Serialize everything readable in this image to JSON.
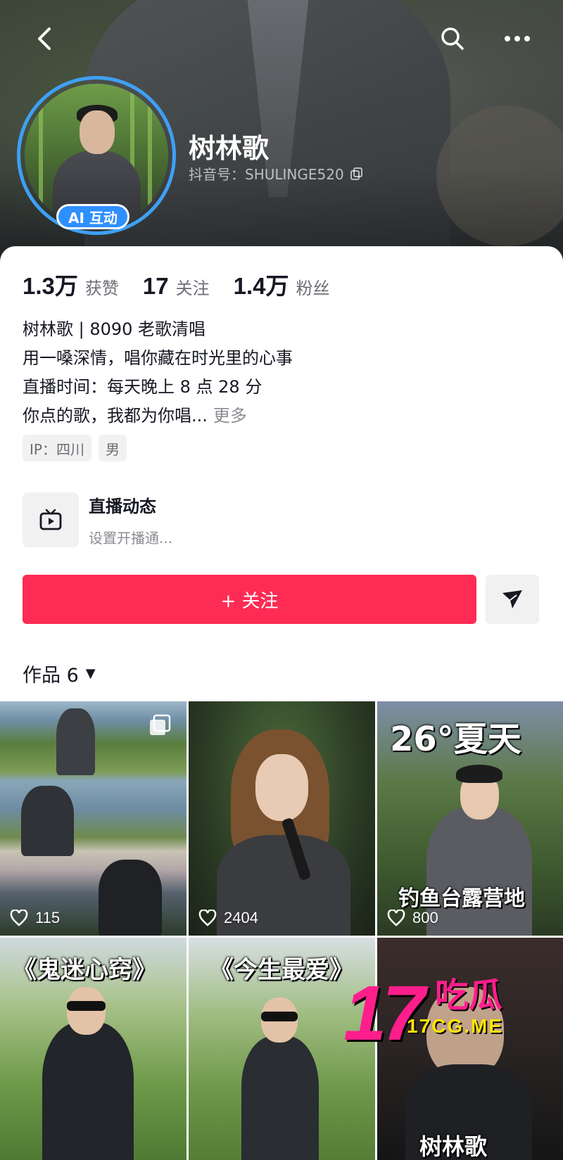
{
  "header": {
    "name": "树林歌",
    "douyin_id": "抖音号：SHULINGE520",
    "ai_badge": "AI 互动"
  },
  "stats": [
    {
      "num": "1.3万",
      "label": "获赞"
    },
    {
      "num": "17",
      "label": "关注"
    },
    {
      "num": "1.4万",
      "label": "粉丝"
    }
  ],
  "bio": {
    "line1": "树林歌 | 8090 老歌清唱",
    "line2": "用一嗓深情，唱你藏在时光里的心事",
    "line3": "直播时间：每天晚上 8 点 28 分",
    "line4": "你点的歌，我都为你唱...",
    "more": "更多"
  },
  "tags": [
    "IP：四川",
    "男"
  ],
  "live": {
    "title": "直播动态",
    "subtitle": "设置开播通..."
  },
  "actions": {
    "follow_label": "+ 关注"
  },
  "works": {
    "label": "作品 6"
  },
  "videos": [
    {
      "likes": "115",
      "title": ""
    },
    {
      "likes": "2404",
      "title": ""
    },
    {
      "likes": "800",
      "title": "26°夏天",
      "caption": "钓鱼台露营地"
    },
    {
      "likes": "",
      "title": "《鬼迷心窍》"
    },
    {
      "likes": "",
      "title": "《今生最爱》"
    },
    {
      "likes": "",
      "title": "树林歌"
    }
  ],
  "watermark": {
    "num": "17",
    "cn": "吃瓜",
    "url": "17CG.ME"
  },
  "colors": {
    "follow": "#fe2c55",
    "badge": "#2e8fff",
    "ring": "#3ea0f4"
  }
}
